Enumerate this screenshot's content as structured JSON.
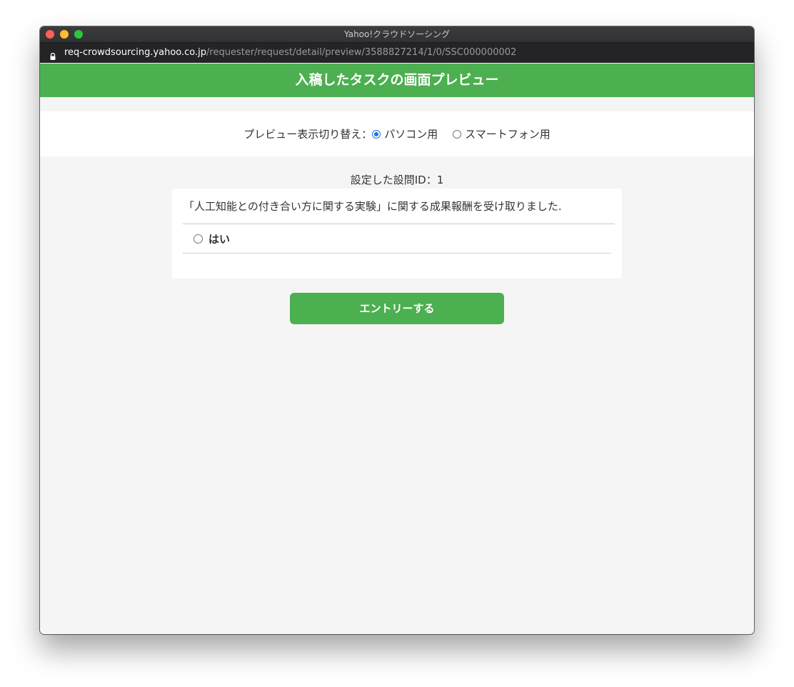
{
  "window": {
    "title": "Yahoo!クラウドソーシング"
  },
  "address_bar": {
    "host": "req-crowdsourcing.yahoo.co.jp",
    "path": "/requester/request/detail/preview/3588827214/1/0/SSC000000002"
  },
  "header": {
    "title": "入稿したタスクの画面プレビュー"
  },
  "preview_toggle": {
    "label": "プレビュー表示切り替え：",
    "options": [
      {
        "label": "パソコン用",
        "checked": true
      },
      {
        "label": "スマートフォン用",
        "checked": false
      }
    ]
  },
  "question": {
    "id_label": "設定した設問ID：1",
    "text": "「人工知能との付き合い方に関する実験」に関する成果報酬を受け取りました.",
    "answers": [
      {
        "label": "はい",
        "checked": false
      }
    ]
  },
  "entry_button": {
    "label": "エントリーする"
  },
  "colors": {
    "accent_green": "#4caf50",
    "radio_blue": "#1a73e8",
    "page_background": "#f5f5f5"
  }
}
